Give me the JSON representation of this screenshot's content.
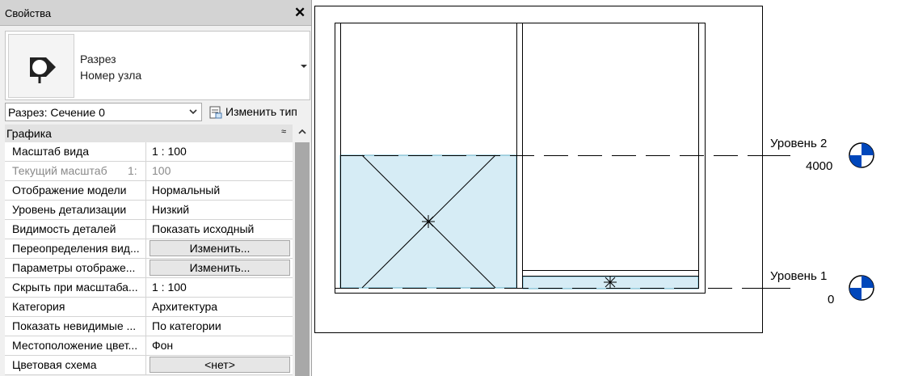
{
  "panel": {
    "title": "Свойства",
    "close_glyph": "✕",
    "type": {
      "line1": "Разрез",
      "line2": "Номер узла",
      "icon": "section-marker-icon"
    },
    "selector": {
      "value": "Разрез: Сечение 0"
    },
    "edit_type_label": "Изменить тип",
    "group": {
      "label": "Графика",
      "collapse_glyph": "≈"
    },
    "rows": [
      {
        "name": "Масштаб вида",
        "value": "1 : 100"
      },
      {
        "name": "Текущий масштаб",
        "num": "1:",
        "value": "100"
      },
      {
        "name": "Отображение модели",
        "value": "Нормальный"
      },
      {
        "name": "Уровень детализации",
        "value": "Низкий"
      },
      {
        "name": "Видимость деталей",
        "value": "Показать исходный"
      },
      {
        "name": "Переопределения вид...",
        "value": "Изменить..."
      },
      {
        "name": "Параметры отображе...",
        "value": "Изменить..."
      },
      {
        "name": "Скрыть при масштаба...",
        "value": "1 : 100"
      },
      {
        "name": "Категория",
        "value": "Архитектура"
      },
      {
        "name": "Показать невидимые ...",
        "value": "По категории"
      },
      {
        "name": "Местоположение цвет...",
        "value": "Фон"
      },
      {
        "name": "Цветовая схема",
        "value": "<нет>"
      }
    ]
  },
  "view": {
    "levels": [
      {
        "name": "Уровень 2",
        "elevation": "4000"
      },
      {
        "name": "Уровень 1",
        "elevation": "0"
      }
    ],
    "colors": {
      "fill": "#d6ecf5",
      "edge": "#63b0c8",
      "marker": "#0047bb"
    }
  }
}
